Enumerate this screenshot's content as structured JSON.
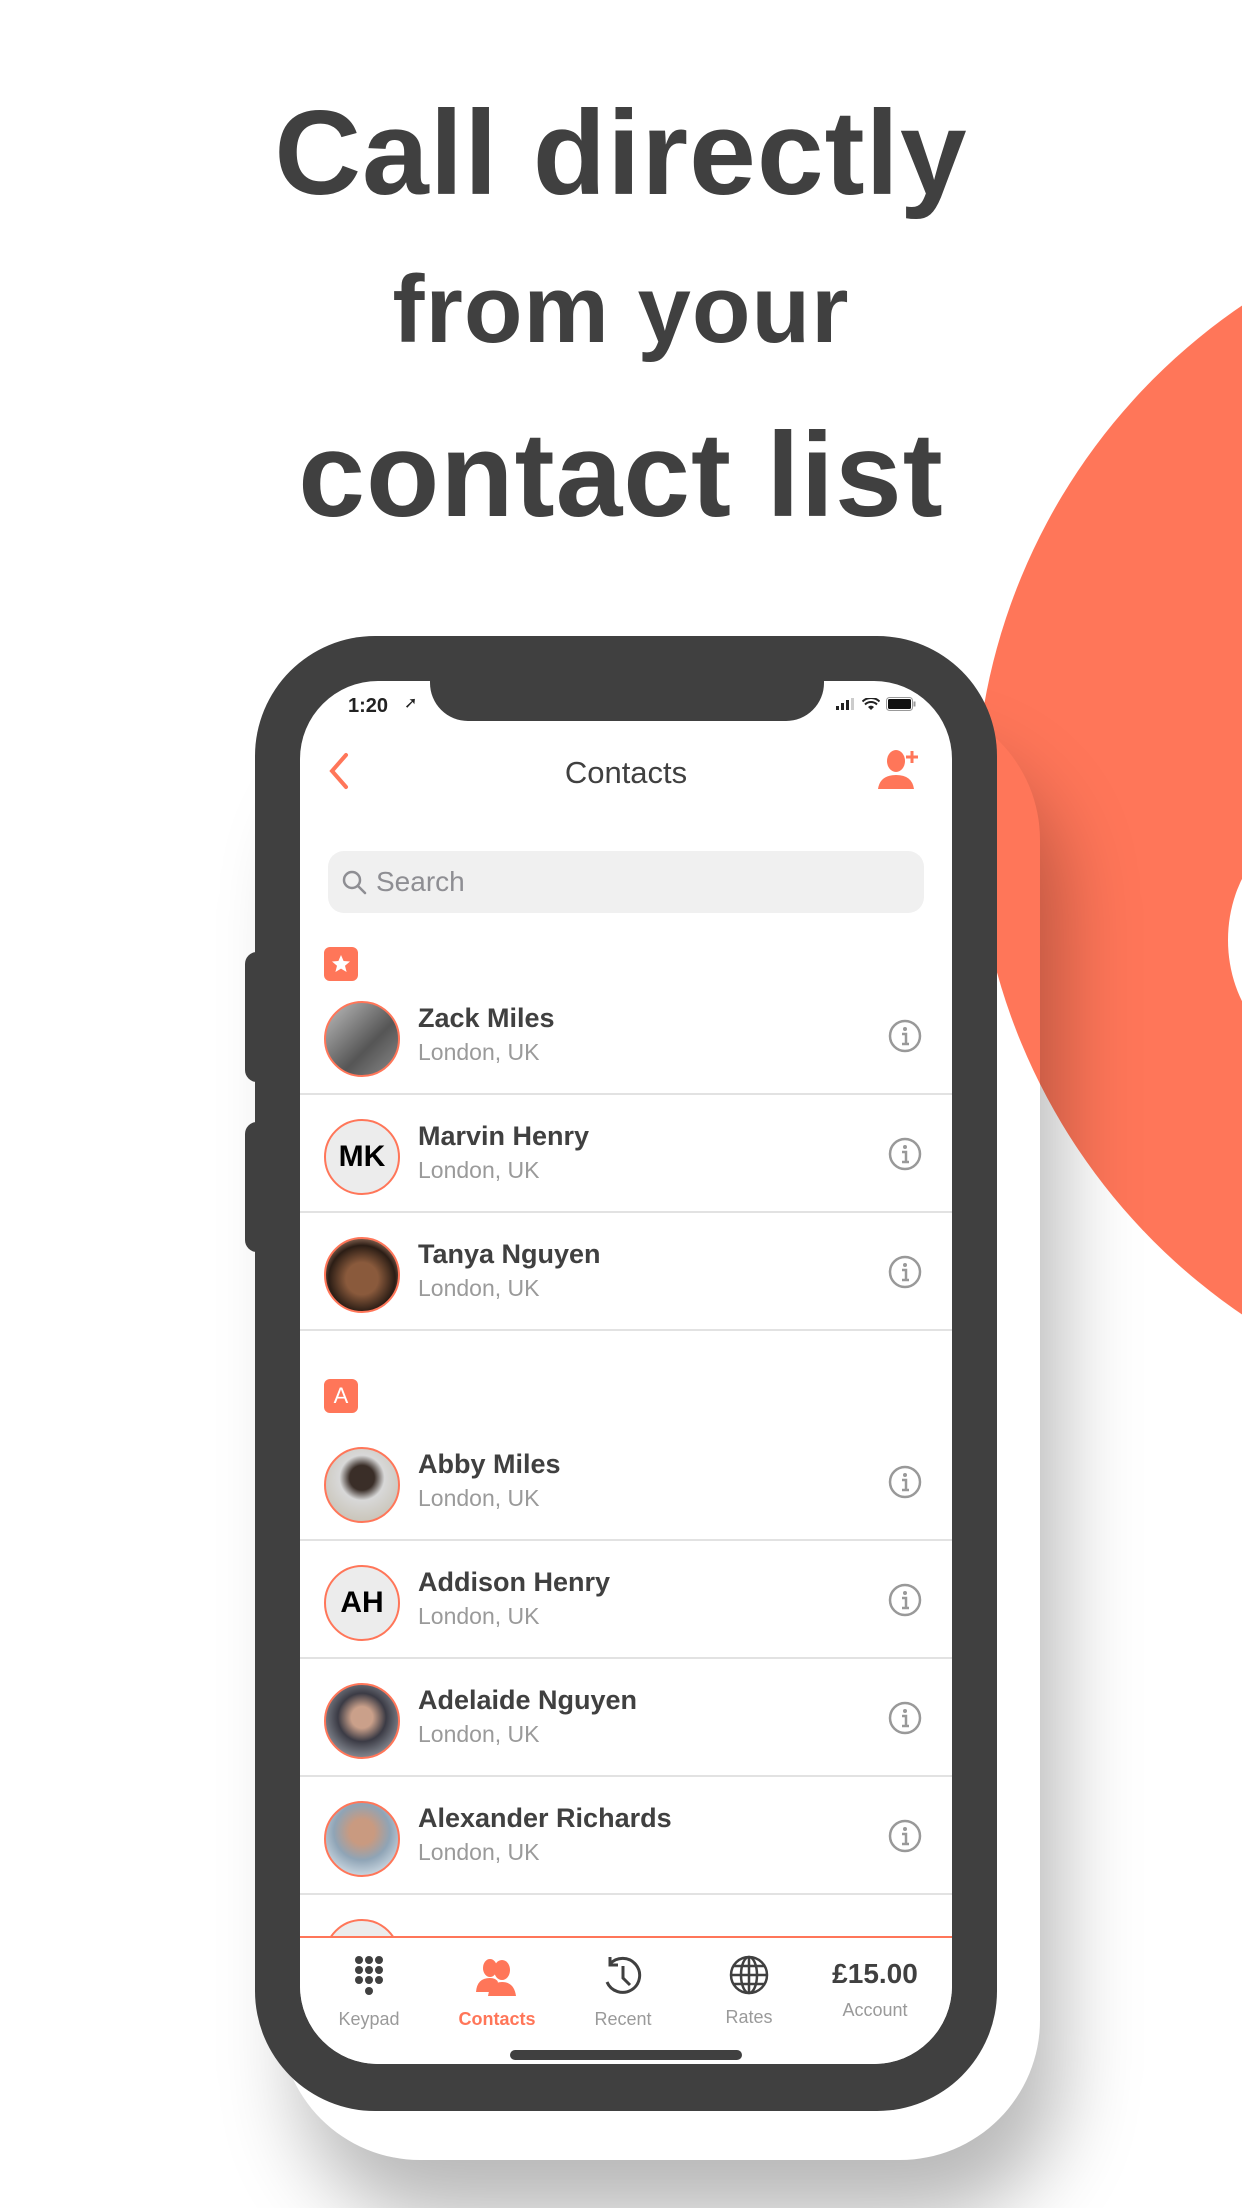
{
  "headline": {
    "line1": "Call directly",
    "line2": "from your",
    "line3": "contact list"
  },
  "colors": {
    "accent": "#ff7659",
    "text": "#404040",
    "muted": "#9a9a9a"
  },
  "status_bar": {
    "time": "1:20",
    "location_icon": "location-arrow-icon",
    "signal_icon": "signal-icon",
    "wifi_icon": "wifi-icon",
    "battery_icon": "battery-icon"
  },
  "nav": {
    "title": "Contacts",
    "back_icon": "chevron-left-icon",
    "add_icon": "add-contact-icon"
  },
  "search": {
    "placeholder": "Search",
    "value": ""
  },
  "sections": [
    {
      "badge": "★",
      "badge_icon": "star-icon",
      "contacts": [
        {
          "name": "Zack Miles",
          "location": "London, UK",
          "avatar": "photo",
          "initials": ""
        },
        {
          "name": "Marvin Henry",
          "location": "London, UK",
          "avatar": "initials",
          "initials": "MK"
        },
        {
          "name": "Tanya Nguyen",
          "location": "London, UK",
          "avatar": "photo",
          "initials": ""
        }
      ]
    },
    {
      "badge": "A",
      "contacts": [
        {
          "name": "Abby Miles",
          "location": "London, UK",
          "avatar": "photo",
          "initials": ""
        },
        {
          "name": "Addison Henry",
          "location": "London, UK",
          "avatar": "initials",
          "initials": "AH"
        },
        {
          "name": "Adelaide Nguyen",
          "location": "London, UK",
          "avatar": "photo",
          "initials": ""
        },
        {
          "name": "Alexander Richards",
          "location": "London, UK",
          "avatar": "photo",
          "initials": ""
        }
      ]
    }
  ],
  "tabs": [
    {
      "label": "Keypad",
      "icon": "keypad-icon",
      "active": false
    },
    {
      "label": "Contacts",
      "icon": "contacts-icon",
      "active": true
    },
    {
      "label": "Recent",
      "icon": "history-icon",
      "active": false
    },
    {
      "label": "Rates",
      "icon": "globe-icon",
      "active": false
    },
    {
      "label": "Account",
      "balance": "£15.00",
      "active": false
    }
  ]
}
